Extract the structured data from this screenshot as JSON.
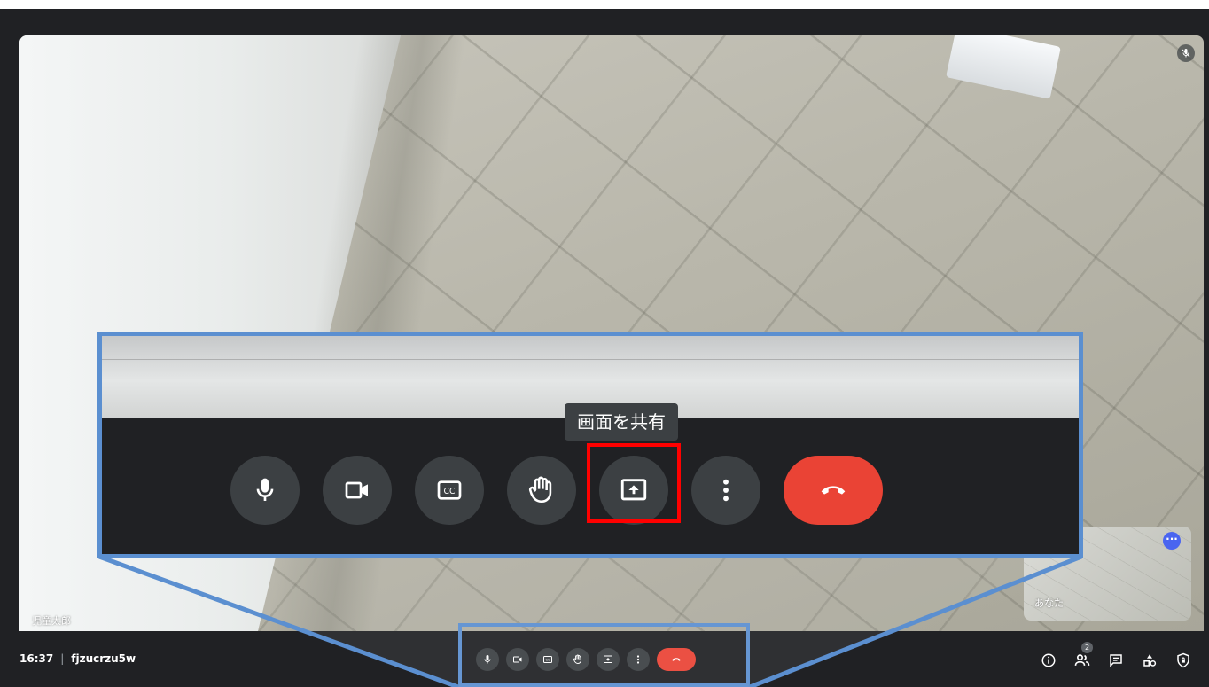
{
  "colors": {
    "background": "#202124",
    "button": "#3c4043",
    "end_call": "#ea4335",
    "callout_border": "#5b8fd0",
    "highlight_box": "#ff0000",
    "self_menu": "#4a65f0"
  },
  "main_video": {
    "participant_name": "児童太郎",
    "mic_indicator_icon": "mic-off-icon"
  },
  "self_view": {
    "name": "あなた",
    "more_label": "···"
  },
  "bottom_bar": {
    "time": "16:37",
    "separator": "|",
    "meeting_code": "fjzucrzu5w",
    "controls": [
      "mic-icon",
      "camera-icon",
      "captions-icon",
      "raise-hand-icon",
      "present-screen-icon",
      "more-options-icon",
      "end-call-icon"
    ],
    "right_icons": [
      "meeting-details-icon",
      "people-icon",
      "chat-icon",
      "activities-icon",
      "host-controls-icon"
    ],
    "participant_count": "2"
  },
  "zoom_callout": {
    "tooltip": "画面を共有",
    "highlighted_control": "present-screen-icon"
  }
}
